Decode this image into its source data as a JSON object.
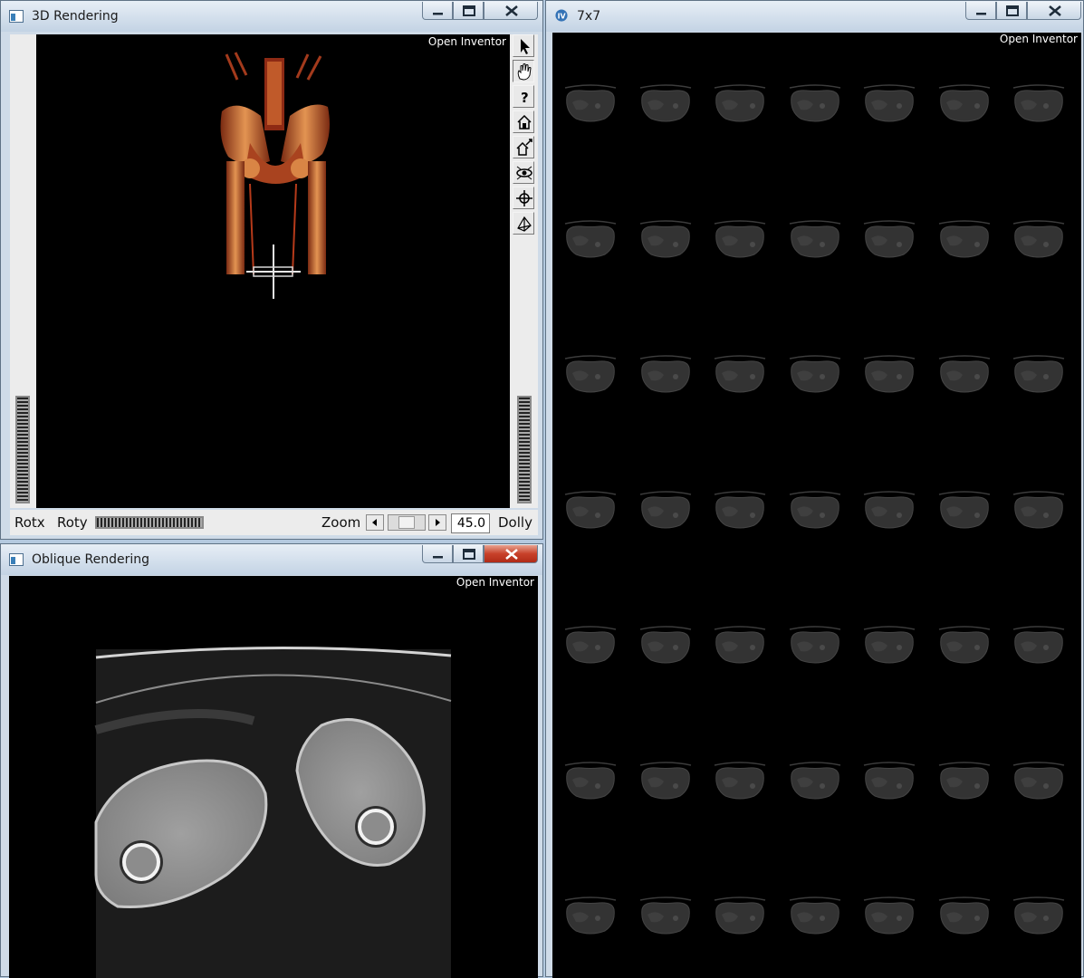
{
  "windows": {
    "rendering3d": {
      "title": "3D Rendering",
      "overlay_label": "Open Inventor"
    },
    "oblique": {
      "title": "Oblique Rendering",
      "overlay_label": "Open Inventor"
    },
    "grid": {
      "title": "7x7",
      "overlay_label": "Open Inventor",
      "rows": 7,
      "columns": 7
    }
  },
  "viewer_controls": {
    "rotx_label": "Rotx",
    "roty_label": "Roty",
    "zoom_label": "Zoom",
    "zoom_value": "45.0",
    "dolly_label": "Dolly"
  },
  "toolbar_icons": [
    "pointer-arrow-icon",
    "hand-icon",
    "question-icon",
    "home-icon",
    "set-home-icon",
    "view-all-icon",
    "seek-icon",
    "perspective-icon"
  ],
  "colors": {
    "close_button_active": "#c8412a",
    "viewport_bg": "#000000",
    "volume_render": "#c2682e"
  }
}
